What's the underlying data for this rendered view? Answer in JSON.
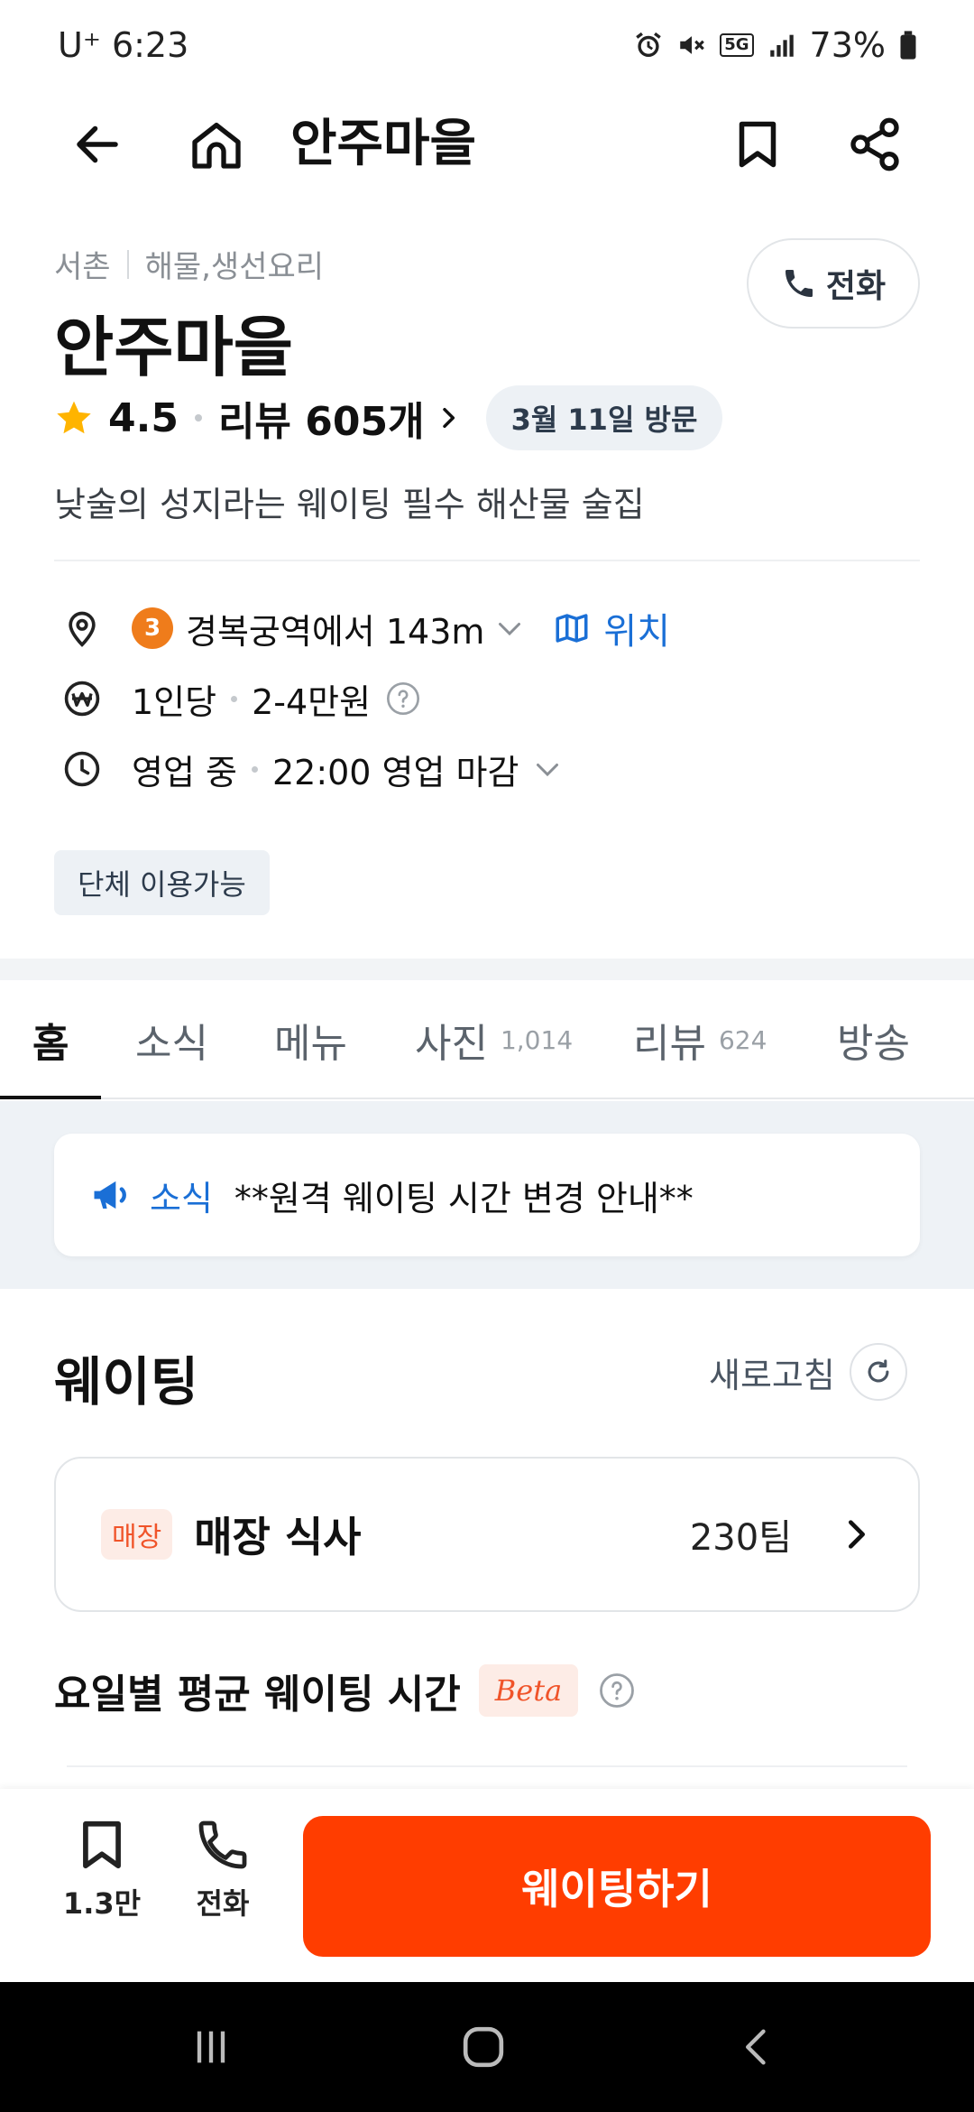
{
  "status_bar": {
    "carrier_time": "U⁺ 6:23",
    "network": "5G",
    "battery": "73%",
    "icons": [
      "alarm-icon",
      "mute-icon",
      "5g-icon",
      "signal-icon",
      "battery-icon"
    ]
  },
  "top_bar": {
    "title": "안주마을",
    "icons": [
      "back-arrow-icon",
      "home-icon",
      "bookmark-icon",
      "share-icon"
    ]
  },
  "store": {
    "area": "서촌",
    "category": "해물,생선요리",
    "name": "안주마을",
    "call_label": "전화",
    "rating": "4.5",
    "review_label": "리뷰 605개",
    "visit_badge": "3월 11일 방문",
    "description": "낮술의 성지라는 웨이팅 필수 해산물 술집"
  },
  "info": {
    "subway_line": "3",
    "subway_line_color": "#ef7c1b",
    "distance": "경복궁역에서 143m",
    "location_link": "위치",
    "price_prefix": "1인당",
    "price_range": "2-4만원",
    "status": "영업 중",
    "closing": "22:00 영업 마감",
    "group_chip": "단체 이용가능"
  },
  "tabs": [
    {
      "label": "홈",
      "count": ""
    },
    {
      "label": "소식",
      "count": ""
    },
    {
      "label": "메뉴",
      "count": ""
    },
    {
      "label": "사진",
      "count": "1,014"
    },
    {
      "label": "리뷰",
      "count": "624"
    },
    {
      "label": "방송",
      "count": ""
    }
  ],
  "news": {
    "label": "소식",
    "text": "**원격 웨이팅 시간 변경 안내**"
  },
  "waiting": {
    "title": "웨이팅",
    "refresh_label": "새로고침",
    "option_tag": "매장",
    "option_name": "매장 식사",
    "option_teams": "230팀",
    "avg_title": "요일별 평균 웨이팅 시간",
    "beta_label": "Beta"
  },
  "bottom_bar": {
    "bookmark_count": "1.3만",
    "call_label": "전화",
    "cta_label": "웨이팅하기"
  },
  "colors": {
    "accent": "#ff3d00",
    "link_blue": "#1a6fd6",
    "tag_bg": "#fdece6",
    "tag_text": "#f0542a"
  }
}
